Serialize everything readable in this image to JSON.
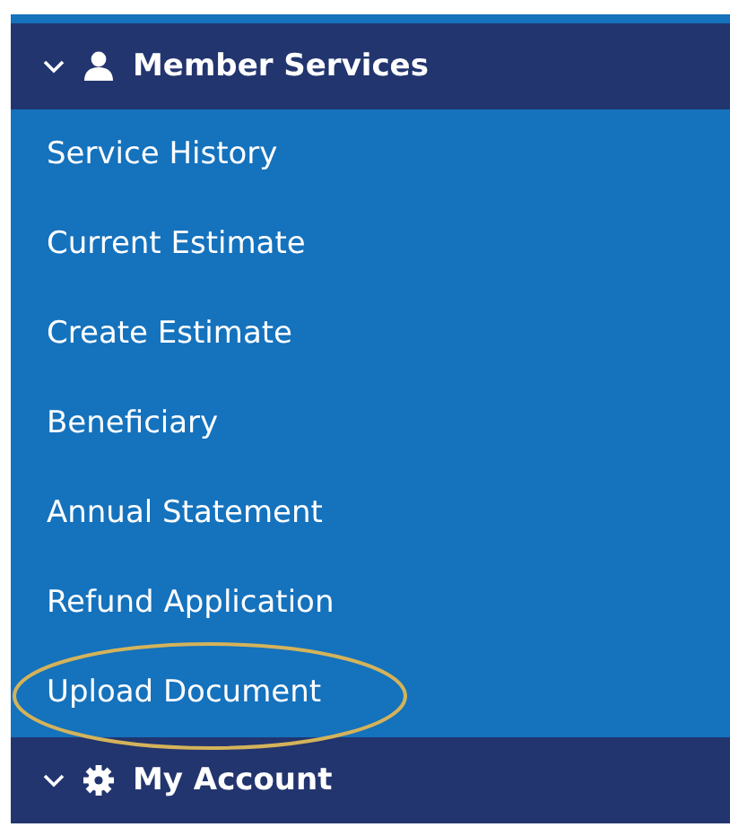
{
  "sections": [
    {
      "title": "Member Services",
      "kind": "user",
      "expanded": true,
      "items": [
        {
          "label": "Service History",
          "circled": false
        },
        {
          "label": "Current Estimate",
          "circled": false
        },
        {
          "label": "Create Estimate",
          "circled": false
        },
        {
          "label": "Beneficiary",
          "circled": false
        },
        {
          "label": "Annual Statement",
          "circled": false
        },
        {
          "label": "Refund Application",
          "circled": false
        },
        {
          "label": "Upload Document",
          "circled": true
        }
      ]
    },
    {
      "title": "My Account",
      "kind": "gear",
      "expanded": true
    }
  ]
}
